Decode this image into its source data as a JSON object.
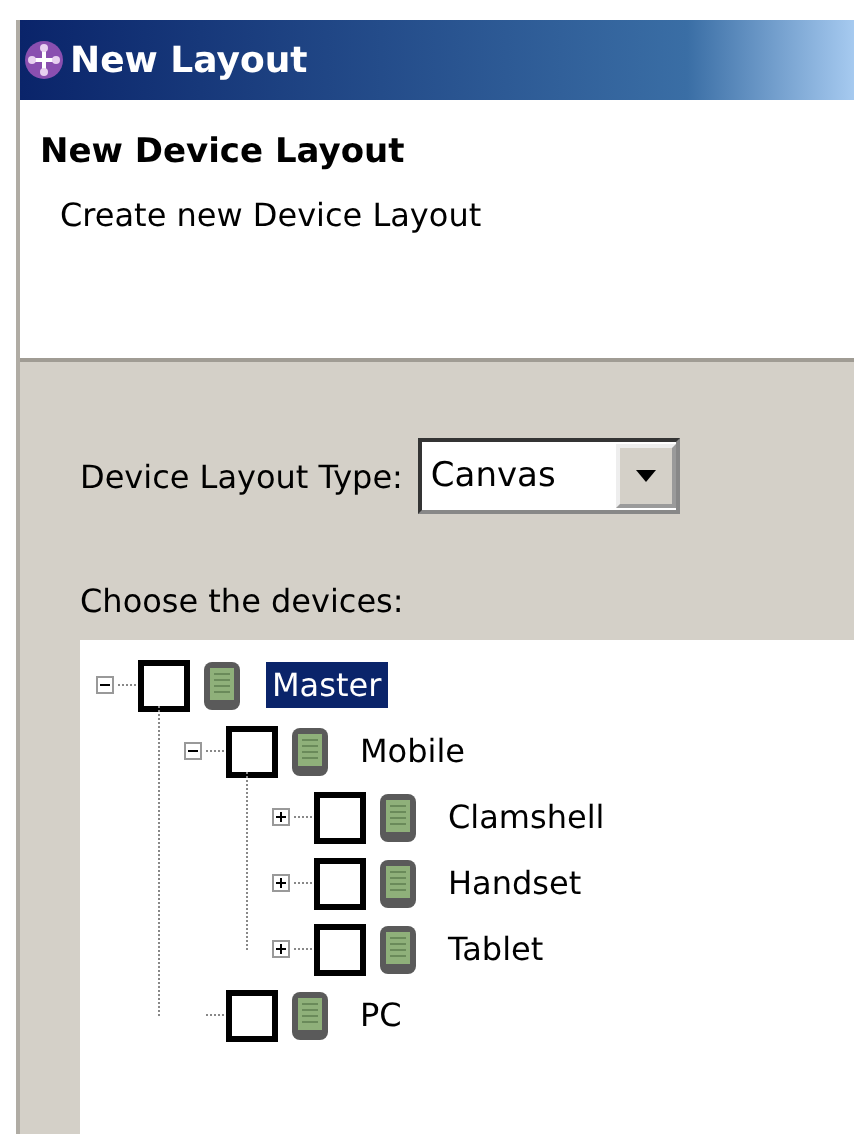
{
  "window": {
    "title": "New Layout"
  },
  "header": {
    "title": "New Device Layout",
    "description": "Create new Device Layout"
  },
  "layout_type": {
    "label": "Device Layout Type:",
    "value": "Canvas"
  },
  "devices": {
    "label": "Choose the devices:",
    "tree": [
      {
        "label": "Master",
        "checked": false,
        "selected": true,
        "expanded": true,
        "children": [
          {
            "label": "Mobile",
            "checked": false,
            "selected": false,
            "expanded": true,
            "children": [
              {
                "label": "Clamshell",
                "checked": false,
                "selected": false,
                "expanded": false
              },
              {
                "label": "Handset",
                "checked": false,
                "selected": false,
                "expanded": false
              },
              {
                "label": "Tablet",
                "checked": false,
                "selected": false,
                "expanded": false
              }
            ]
          },
          {
            "label": "PC",
            "checked": false,
            "selected": false
          }
        ]
      }
    ]
  }
}
